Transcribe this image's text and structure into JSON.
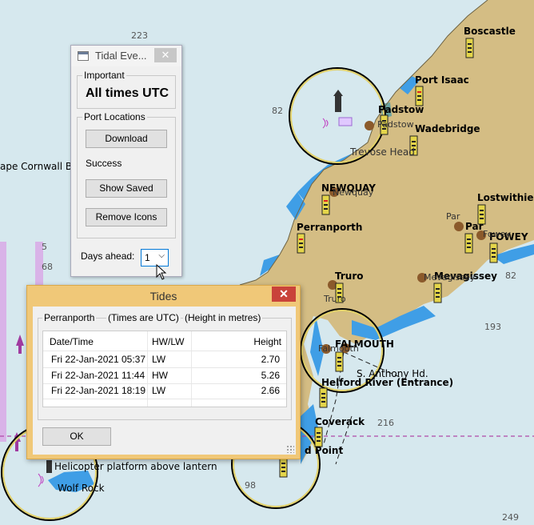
{
  "map": {
    "depths": [
      "223",
      "82",
      "68",
      "82",
      "193",
      "216",
      "98",
      "249",
      "5"
    ],
    "places": {
      "boscastle": "Boscastle",
      "port_isaac": "Port Isaac",
      "padstow": "Padstow",
      "padstow_shadow": "Padstow",
      "wadebridge": "Wadebridge",
      "trevose_head": "Trevose Head",
      "cape_cornwall": "ape Cornwall Ba",
      "newquay": "NEWQUAY",
      "newquay_shadow": "Newquay",
      "lostwithiel": "Lostwithiel",
      "par": "Par",
      "par_shadow": "Par",
      "fowey": "FOWEY",
      "fowey_shadow": "Fowey",
      "perranporth": "Perranporth",
      "mevagissey": "Mevagissey",
      "mevagissey_shadow": "Mevagissey",
      "truro": "Truro",
      "truro_shadow": "Truro",
      "falmouth": "FALMOUTH",
      "falmouth_shadow": "Falmouth",
      "st_anthony": "S. Anthony Hd.",
      "helford": "Helford River (Entrance)",
      "coverack": "Coverack",
      "point": "d Point",
      "helicopter": "Helicopter platform above lantern",
      "wolf_rock": "Wolf Rock"
    },
    "colors": {
      "sea": "#d6e8ee",
      "land": "#d4bd84",
      "shallow": "#3f9ee6",
      "tide_marker": "#e4d54a",
      "town_dot": "#8b5a2b"
    }
  },
  "tidal_window": {
    "title": "Tidal Eve...",
    "close_glyph": "✕",
    "important_legend": "Important",
    "all_times": "All times UTC",
    "ports_legend": "Port Locations",
    "download": "Download",
    "status": "Success",
    "show_saved": "Show Saved",
    "remove_icons": "Remove Icons",
    "days_label": "Days ahead:",
    "days_value": "1"
  },
  "tides_dialog": {
    "title": "Tides",
    "close_glyph": "✕",
    "port": "Perranporth",
    "times_note": "(Times are UTC)",
    "height_note": "(Height in metres)",
    "headers": {
      "datetime": "Date/Time",
      "hwlw": "HW/LW",
      "height": "Height"
    },
    "rows": [
      {
        "date": "Fri 22-Jan-2021",
        "time": "05:37",
        "type": "LW",
        "height": "2.70"
      },
      {
        "date": "Fri 22-Jan-2021",
        "time": "11:44",
        "type": "HW",
        "height": "5.26"
      },
      {
        "date": "Fri 22-Jan-2021",
        "time": "18:19",
        "type": "LW",
        "height": "2.66"
      }
    ],
    "ok": "OK"
  }
}
